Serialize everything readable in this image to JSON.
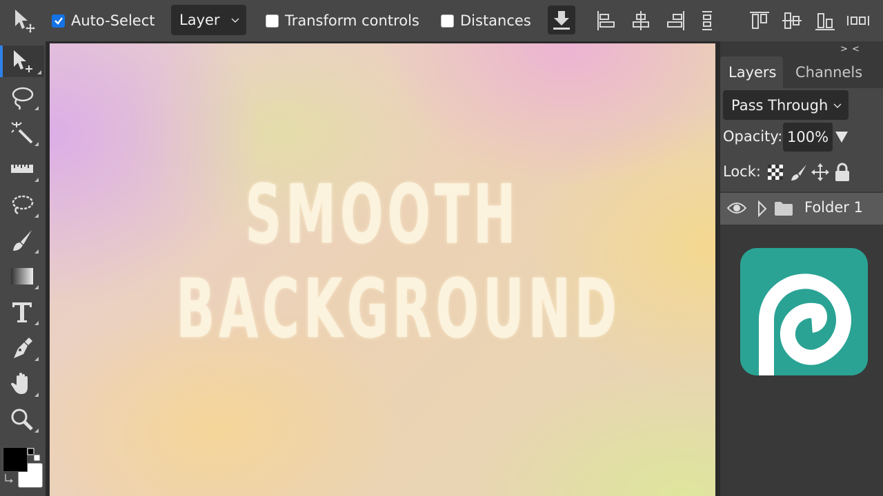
{
  "toolbar": {
    "auto_select_label": "Auto-Select",
    "auto_select_checked": true,
    "layer_select_value": "Layer",
    "transform_controls_label": "Transform controls",
    "transform_controls_checked": false,
    "distances_label": "Distances",
    "distances_checked": false
  },
  "tools": [
    {
      "name": "move-tool",
      "icon": "move-icon",
      "active": true
    },
    {
      "name": "lasso-tool",
      "icon": "lasso-icon"
    },
    {
      "name": "magic-wand-tool",
      "icon": "magic-wand-icon"
    },
    {
      "name": "ruler-tool",
      "icon": "ruler-icon"
    },
    {
      "name": "spot-heal-tool",
      "icon": "heal-icon"
    },
    {
      "name": "brush-tool",
      "icon": "brush-icon"
    },
    {
      "name": "gradient-tool",
      "icon": "gradient-icon"
    },
    {
      "name": "type-tool",
      "icon": "type-icon"
    },
    {
      "name": "pen-tool",
      "icon": "pen-icon"
    },
    {
      "name": "hand-tool",
      "icon": "hand-icon"
    },
    {
      "name": "zoom-tool",
      "icon": "zoom-icon"
    }
  ],
  "colors": {
    "foreground": "#000000",
    "background": "#ffffff",
    "accent": "#1473e6",
    "logo": "#2aa394"
  },
  "canvas": {
    "line1": "SMOOTH",
    "line2": "BACKGROUND"
  },
  "panel": {
    "collapse_label": "> <",
    "tabs": [
      {
        "label": "Layers",
        "active": true
      },
      {
        "label": "Channels",
        "active": false
      }
    ],
    "blend_mode": "Pass Through",
    "opacity_label": "Opacity:",
    "opacity_value": "100%",
    "lock_label": "Lock:",
    "layers": [
      {
        "name": "Folder 1",
        "type": "folder",
        "visible": true
      }
    ]
  }
}
